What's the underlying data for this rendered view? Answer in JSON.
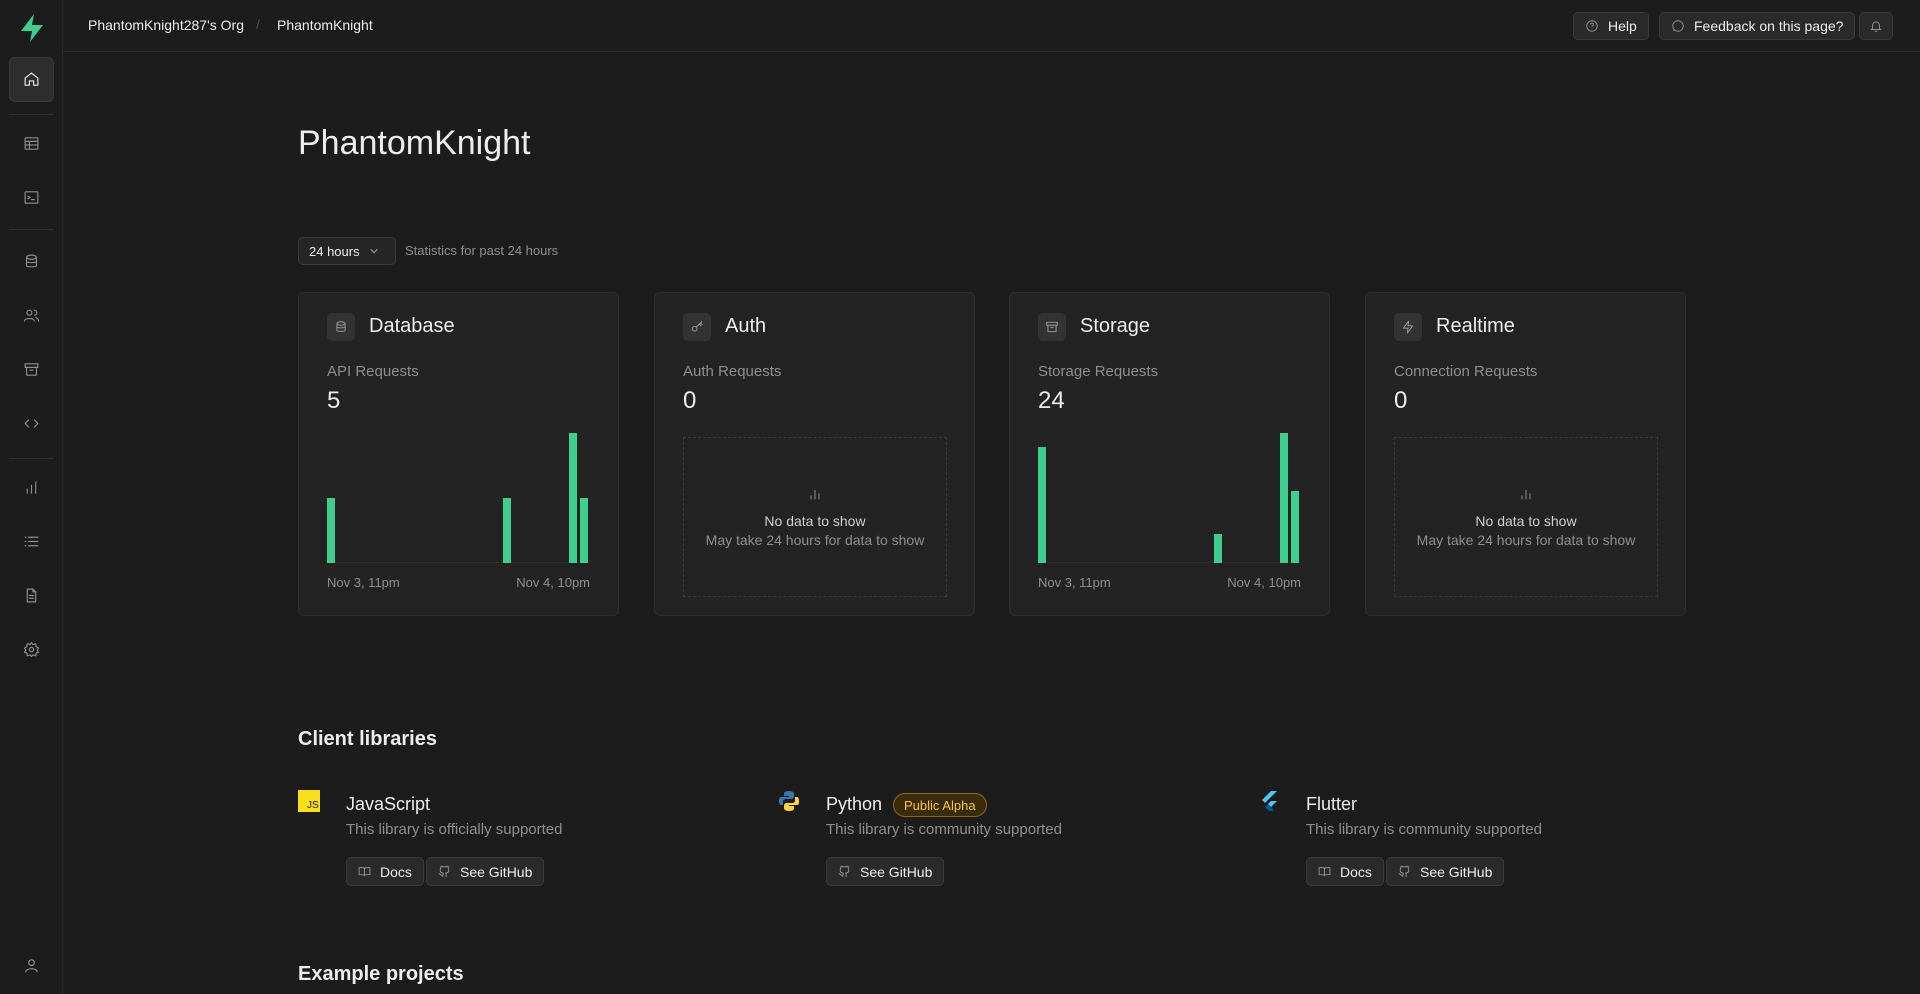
{
  "breadcrumb": {
    "org": "PhantomKnight287's Org",
    "project": "PhantomKnight",
    "separator": "/"
  },
  "topbar": {
    "help": "Help",
    "feedback": "Feedback on this page?"
  },
  "sidebar": {
    "items": [
      {
        "icon": "home-icon",
        "active": true
      },
      {
        "icon": "table-editor-icon"
      },
      {
        "icon": "sql-editor-icon"
      },
      {
        "icon": "database-icon"
      },
      {
        "icon": "auth-users-icon"
      },
      {
        "icon": "storage-icon"
      },
      {
        "icon": "edge-functions-icon"
      },
      {
        "icon": "reports-icon"
      },
      {
        "icon": "logs-icon"
      },
      {
        "icon": "api-docs-icon"
      },
      {
        "icon": "settings-icon"
      },
      {
        "icon": "account-icon"
      }
    ]
  },
  "page_title": "PhantomKnight",
  "stats": {
    "range": "24 hours",
    "caption": "Statistics for past 24 hours"
  },
  "cards": [
    {
      "title": "Database",
      "label": "API Requests",
      "value": "5",
      "icon": "database-icon",
      "start": "Nov 3, 11pm",
      "end": "Nov 4, 10pm"
    },
    {
      "title": "Auth",
      "label": "Auth Requests",
      "value": "0",
      "icon": "key-icon",
      "nodata": "No data to show",
      "nodata_sub": "May take 24 hours for data to show"
    },
    {
      "title": "Storage",
      "label": "Storage Requests",
      "value": "24",
      "icon": "archive-icon",
      "start": "Nov 3, 11pm",
      "end": "Nov 4, 10pm"
    },
    {
      "title": "Realtime",
      "label": "Connection Requests",
      "value": "0",
      "icon": "zap-icon",
      "nodata": "No data to show",
      "nodata_sub": "May take 24 hours for data to show"
    }
  ],
  "chart_data": [
    {
      "type": "bar",
      "title": "API Requests",
      "x_start": "Nov 3, 11pm",
      "x_end": "Nov 4, 10pm",
      "values": [
        1,
        0,
        0,
        0,
        0,
        0,
        0,
        0,
        0,
        0,
        0,
        0,
        0,
        0,
        0,
        0,
        1,
        0,
        0,
        0,
        0,
        0,
        2,
        1
      ]
    },
    {
      "type": "bar",
      "title": "Storage Requests",
      "x_start": "Nov 3, 11pm",
      "x_end": "Nov 4, 10pm",
      "values": [
        8,
        0,
        0,
        0,
        0,
        0,
        0,
        0,
        0,
        0,
        0,
        0,
        0,
        0,
        0,
        0,
        2,
        0,
        0,
        0,
        0,
        0,
        9,
        5
      ]
    }
  ],
  "libraries_title": "Client libraries",
  "libraries": [
    {
      "name": "JavaScript",
      "desc": "This library is officially supported",
      "docs": "Docs",
      "github": "See GitHub"
    },
    {
      "name": "Python",
      "badge": "Public Alpha",
      "desc": "This library is community supported",
      "github": "See GitHub"
    },
    {
      "name": "Flutter",
      "desc": "This library is community supported",
      "docs": "Docs",
      "github": "See GitHub"
    }
  ],
  "js_logo_text": "JS",
  "examples_title": "Example projects",
  "colors": {
    "accent": "#3ecf8e",
    "bg": "#1c1c1c",
    "card": "#232323",
    "badge": "#f5c542"
  }
}
